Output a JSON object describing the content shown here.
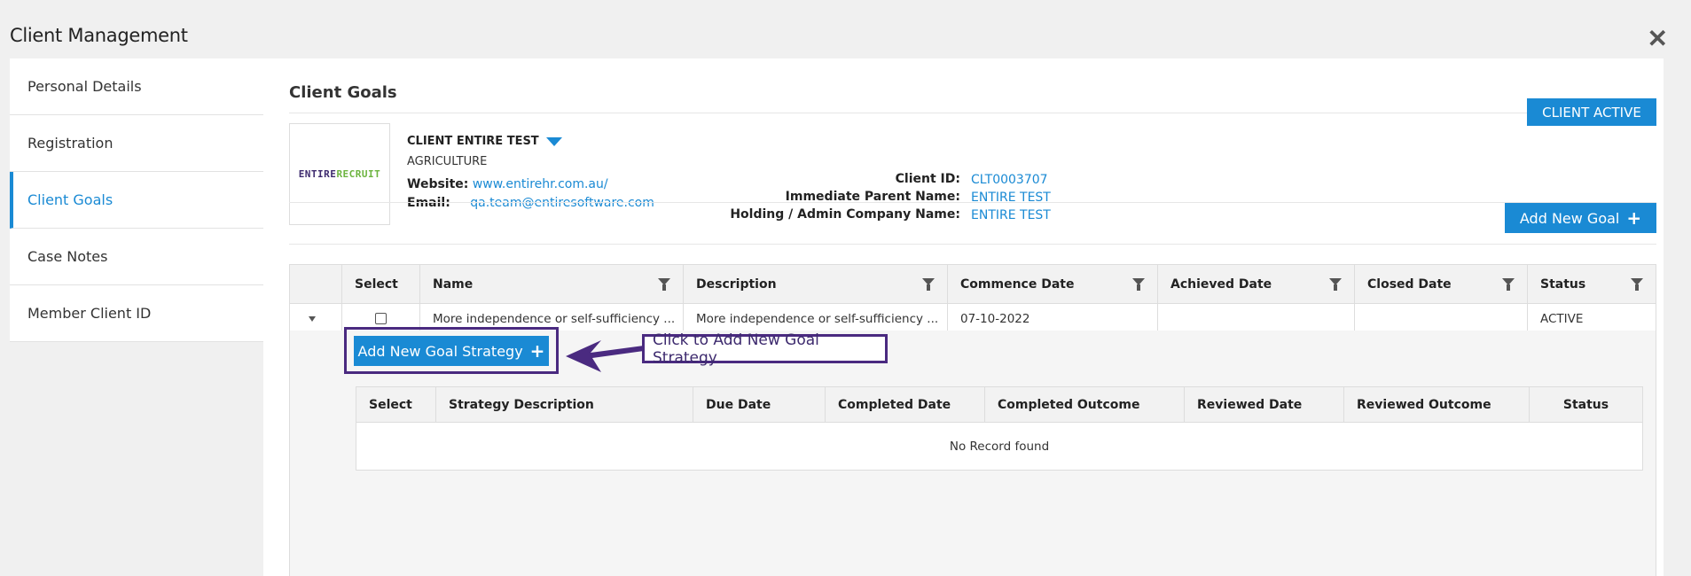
{
  "window": {
    "title": "Client Management",
    "close_glyph": "✕"
  },
  "sidebar": {
    "items": [
      {
        "label": "Personal Details"
      },
      {
        "label": "Registration"
      },
      {
        "label": "Client Goals"
      },
      {
        "label": "Case Notes"
      },
      {
        "label": "Member Client ID"
      }
    ]
  },
  "main": {
    "section_title": "Client Goals",
    "logo": {
      "part1": "ENTIRE",
      "part2": "RECRUIT"
    },
    "client": {
      "name": "CLIENT ENTIRE TEST",
      "industry": "AGRICULTURE",
      "website_label": "Website:",
      "website_value": "www.entirehr.com.au/",
      "email_label": "Email:",
      "email_value": "qa.team@entiresoftware.com",
      "client_id_label": "Client ID:",
      "client_id_value": "CLT0003707",
      "parent_label": "Immediate Parent Name:",
      "parent_value": "ENTIRE TEST",
      "holding_label": "Holding / Admin Company Name:",
      "holding_value": "ENTIRE TEST"
    },
    "status_button": "CLIENT ACTIVE",
    "add_goal_button": "Add New Goal",
    "goals_table": {
      "headers": [
        "",
        "Select",
        "Name",
        "Description",
        "Commence Date",
        "Achieved Date",
        "Closed Date",
        "Status"
      ],
      "rows": [
        {
          "name": "More independence or self-sufficiency ...",
          "description": "More independence or self-sufficiency ...",
          "commence_date": "07-10-2022",
          "achieved_date": "",
          "closed_date": "",
          "status": "ACTIVE"
        }
      ]
    },
    "add_strategy_button": "Add New Goal Strategy",
    "callout_text": "Click to Add New Goal Strategy",
    "strategy_table": {
      "headers": [
        "Select",
        "Strategy Description",
        "Due Date",
        "Completed Date",
        "Completed Outcome",
        "Reviewed Date",
        "Reviewed Outcome",
        "Status"
      ],
      "empty_message": "No Record found"
    }
  },
  "colors": {
    "accent": "#1a8ad4",
    "annotation": "#4a2a80",
    "logo_primary": "#3d2a6e",
    "logo_secondary": "#6cb43f"
  }
}
